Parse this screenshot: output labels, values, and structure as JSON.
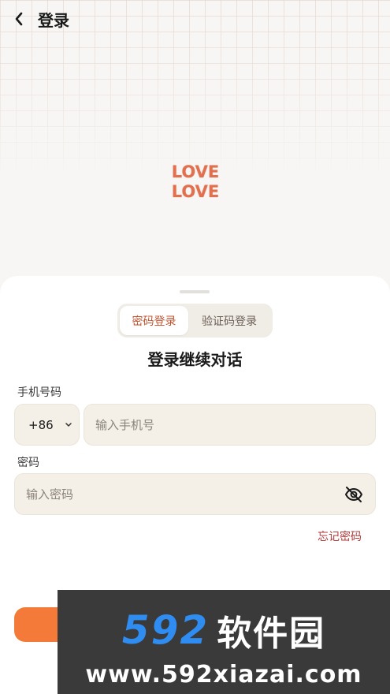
{
  "header": {
    "title": "登录"
  },
  "logo": {
    "line1": "LOVE",
    "line2": "LOVE"
  },
  "tabs": [
    {
      "label": "密码登录",
      "active": true
    },
    {
      "label": "验证码登录",
      "active": false
    }
  ],
  "form": {
    "title": "登录继续对话",
    "phone_label": "手机号码",
    "country_code": "+86",
    "phone_placeholder": "输入手机号",
    "password_label": "密码",
    "password_placeholder": "输入密码",
    "forgot_label": "忘记密码"
  },
  "watermark": {
    "number": "592",
    "name": "软件园",
    "url": "www.592xiazai.com"
  },
  "colors": {
    "accent": "#c2512d",
    "button": "#f47a3a",
    "logo": "#e0704f",
    "input_bg": "#f4efe7"
  }
}
